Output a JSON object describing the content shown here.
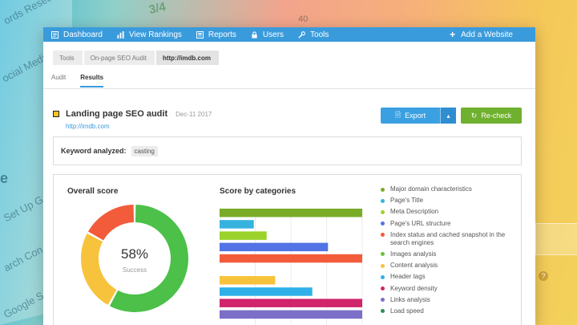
{
  "background": {
    "texts": [
      "ords Research",
      "ocial Media",
      "e",
      "Set Up G",
      "arch Con",
      "Google S"
    ],
    "fraction": "3/4",
    "number": "40"
  },
  "nav": {
    "items": [
      {
        "label": "Dashboard",
        "icon": "dashboard-icon"
      },
      {
        "label": "View Rankings",
        "icon": "bar-chart-icon"
      },
      {
        "label": "Reports",
        "icon": "reports-icon"
      },
      {
        "label": "Users",
        "icon": "lock-icon"
      },
      {
        "label": "Tools",
        "icon": "tools-icon"
      }
    ],
    "add_label": "Add a Website"
  },
  "breadcrumb": [
    "Tools",
    "On-page SEO Audit",
    "http://imdb.com"
  ],
  "tabs": [
    {
      "label": "Audit",
      "active": false
    },
    {
      "label": "Results",
      "active": true
    }
  ],
  "audit": {
    "title": "Landing page SEO audit",
    "date": "Dec-11 2017",
    "url": "http://imdb.com"
  },
  "buttons": {
    "export": "Export",
    "recheck": "Re-check"
  },
  "keyword": {
    "label": "Keyword analyzed:",
    "value": "casting"
  },
  "overall": {
    "title": "Overall score",
    "percent": "58%",
    "status": "Success",
    "segments": [
      {
        "value": 58,
        "color": "#4cc049"
      },
      {
        "value": 25,
        "color": "#f7c33c"
      },
      {
        "value": 17,
        "color": "#f25c3b"
      }
    ]
  },
  "categories": {
    "title": "Score by categories",
    "bar_max": 100,
    "bars": [
      {
        "value": 100,
        "color": "#7aac28"
      },
      {
        "value": 24,
        "color": "#35b3de"
      },
      {
        "value": 33,
        "color": "#9bd22b"
      },
      {
        "value": 76,
        "color": "#5272e6"
      },
      {
        "value": 100,
        "color": "#f25c3b"
      },
      {
        "value": 39,
        "color": "#f7c33c"
      },
      {
        "value": 65,
        "color": "#2fb0e8"
      },
      {
        "value": 100,
        "color": "#d0246b"
      },
      {
        "value": 100,
        "color": "#7b6fc9"
      }
    ],
    "legend": [
      {
        "label": "Major domain characteristics",
        "color": "#7aac28"
      },
      {
        "label": "Page's Title",
        "color": "#35b3de"
      },
      {
        "label": "Meta Description",
        "color": "#9bd22b"
      },
      {
        "label": "Page's URL structure",
        "color": "#5272e6"
      },
      {
        "label": "Index status and cached snapshot in the search engines",
        "color": "#f25c3b"
      },
      {
        "label": "Images analysis",
        "color": "#6fbf3a"
      },
      {
        "label": "Content analysis",
        "color": "#f7c33c"
      },
      {
        "label": "Header tags",
        "color": "#2fb0e8"
      },
      {
        "label": "Keyword density",
        "color": "#d0246b"
      },
      {
        "label": "Links analysis",
        "color": "#7b6fc9"
      },
      {
        "label": "Load speed",
        "color": "#2e8b57"
      }
    ]
  }
}
